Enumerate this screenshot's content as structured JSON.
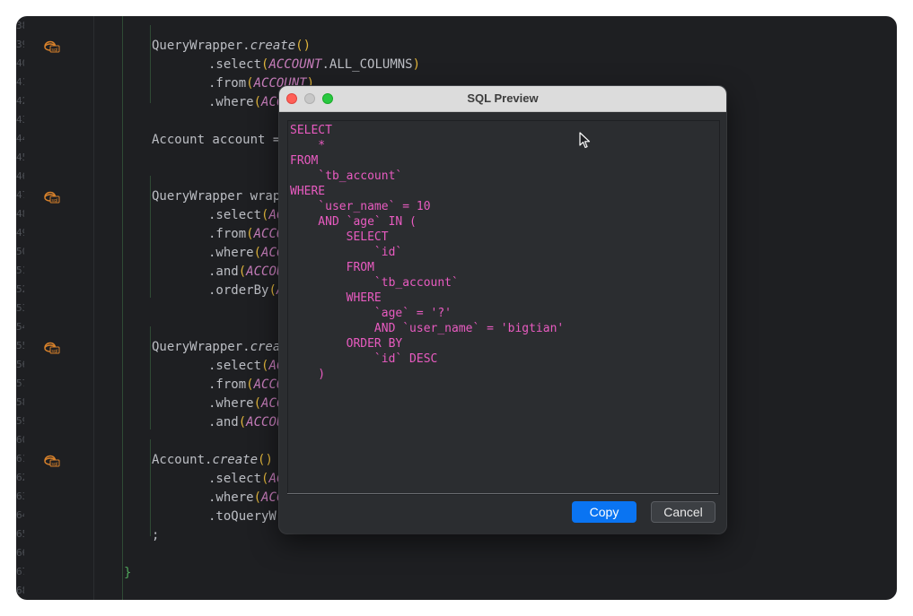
{
  "editor": {
    "lines": [
      {
        "n": "38",
        "y": 0,
        "x": 0,
        "icon": false,
        "tokens": []
      },
      {
        "n": "39",
        "icon": true,
        "indent": 2,
        "tokens": [
          [
            "plain",
            "QueryWrapper."
          ],
          [
            "italic",
            "create"
          ],
          [
            "paren",
            "()"
          ]
        ]
      },
      {
        "n": "40",
        "icon": false,
        "indent": 3,
        "tokens": [
          [
            "plain",
            ".select"
          ],
          [
            "paren",
            "("
          ],
          [
            "const",
            "ACCOUNT"
          ],
          [
            "plain",
            ".ALL_COLUMNS"
          ],
          [
            "paren",
            ")"
          ]
        ]
      },
      {
        "n": "41",
        "icon": false,
        "indent": 3,
        "tokens": [
          [
            "plain",
            ".from"
          ],
          [
            "paren",
            "("
          ],
          [
            "const",
            "ACCOUNT"
          ],
          [
            "paren",
            ")"
          ]
        ]
      },
      {
        "n": "42",
        "icon": false,
        "indent": 3,
        "tokens": [
          [
            "plain",
            ".where"
          ],
          [
            "paren",
            "("
          ],
          [
            "const",
            "ACCO"
          ]
        ]
      },
      {
        "n": "43",
        "icon": false,
        "tokens": []
      },
      {
        "n": "44",
        "icon": false,
        "indent": 2,
        "tokens": [
          [
            "plain",
            "Account account ="
          ]
        ]
      },
      {
        "n": "45",
        "icon": false,
        "tokens": []
      },
      {
        "n": "46",
        "icon": false,
        "tokens": []
      },
      {
        "n": "47",
        "icon": true,
        "indent": 2,
        "tokens": [
          [
            "plain",
            "QueryWrapper wrapp"
          ]
        ]
      },
      {
        "n": "48",
        "icon": false,
        "indent": 3,
        "tokens": [
          [
            "plain",
            ".select"
          ],
          [
            "paren",
            "("
          ],
          [
            "const",
            "AC"
          ]
        ]
      },
      {
        "n": "49",
        "icon": false,
        "indent": 3,
        "tokens": [
          [
            "plain",
            ".from"
          ],
          [
            "paren",
            "("
          ],
          [
            "const",
            "ACCO"
          ]
        ]
      },
      {
        "n": "50",
        "icon": false,
        "indent": 3,
        "tokens": [
          [
            "plain",
            ".where"
          ],
          [
            "paren",
            "("
          ],
          [
            "const",
            "ACC"
          ]
        ]
      },
      {
        "n": "51",
        "icon": false,
        "indent": 3,
        "tokens": [
          [
            "plain",
            ".and"
          ],
          [
            "paren",
            "("
          ],
          [
            "const",
            "ACCOU"
          ]
        ]
      },
      {
        "n": "52",
        "icon": false,
        "indent": 3,
        "tokens": [
          [
            "plain",
            ".orderBy"
          ],
          [
            "paren",
            "("
          ],
          [
            "const",
            "A"
          ]
        ]
      },
      {
        "n": "53",
        "icon": false,
        "tokens": []
      },
      {
        "n": "54",
        "icon": false,
        "tokens": []
      },
      {
        "n": "55",
        "icon": true,
        "indent": 2,
        "tokens": [
          [
            "plain",
            "QueryWrapper."
          ],
          [
            "italic",
            "creat"
          ]
        ]
      },
      {
        "n": "56",
        "icon": false,
        "indent": 3,
        "tokens": [
          [
            "plain",
            ".select"
          ],
          [
            "paren",
            "("
          ],
          [
            "const",
            "AC"
          ]
        ]
      },
      {
        "n": "57",
        "icon": false,
        "indent": 3,
        "tokens": [
          [
            "plain",
            ".from"
          ],
          [
            "paren",
            "("
          ],
          [
            "const",
            "ACCO"
          ]
        ]
      },
      {
        "n": "58",
        "icon": false,
        "indent": 3,
        "tokens": [
          [
            "plain",
            ".where"
          ],
          [
            "paren",
            "("
          ],
          [
            "const",
            "ACC"
          ]
        ]
      },
      {
        "n": "59",
        "icon": false,
        "indent": 3,
        "tokens": [
          [
            "plain",
            ".and"
          ],
          [
            "paren",
            "("
          ],
          [
            "const",
            "ACCOU"
          ]
        ]
      },
      {
        "n": "60",
        "icon": false,
        "tokens": []
      },
      {
        "n": "61",
        "icon": true,
        "indent": 2,
        "tokens": [
          [
            "plain",
            "Account."
          ],
          [
            "italic",
            "create"
          ],
          [
            "paren",
            "()"
          ]
        ]
      },
      {
        "n": "62",
        "icon": false,
        "indent": 3,
        "tokens": [
          [
            "plain",
            ".select"
          ],
          [
            "paren",
            "("
          ],
          [
            "const",
            "AC"
          ]
        ]
      },
      {
        "n": "63",
        "icon": false,
        "indent": 3,
        "tokens": [
          [
            "plain",
            ".where"
          ],
          [
            "paren",
            "("
          ],
          [
            "const",
            "ACC"
          ]
        ]
      },
      {
        "n": "64",
        "icon": false,
        "indent": 3,
        "tokens": [
          [
            "plain",
            ".toQueryWr"
          ]
        ]
      },
      {
        "n": "65",
        "icon": false,
        "indent": 2,
        "tokens": [
          [
            "plain",
            ";"
          ]
        ]
      },
      {
        "n": "66",
        "icon": false,
        "tokens": []
      },
      {
        "n": "67",
        "icon": false,
        "indent": 1,
        "tokens": [
          [
            "brace",
            "}"
          ]
        ]
      },
      {
        "n": "68",
        "icon": false,
        "tokens": []
      }
    ]
  },
  "dialog": {
    "title": "SQL Preview",
    "sql_lines": [
      "SELECT",
      "    *",
      "FROM",
      "    `tb_account`",
      "WHERE",
      "    `user_name` = 10",
      "    AND `age` IN (",
      "        SELECT",
      "            `id`",
      "        FROM",
      "            `tb_account`",
      "        WHERE",
      "            `age` = '?'",
      "            AND `user_name` = 'bigtian'",
      "        ORDER BY",
      "            `id` DESC",
      "    )"
    ],
    "copy_label": "Copy",
    "cancel_label": "Cancel"
  },
  "colors": {
    "editor_bg": "#1e1f22",
    "sql_text": "#e85bc0",
    "accent_button": "#0a74f2"
  }
}
